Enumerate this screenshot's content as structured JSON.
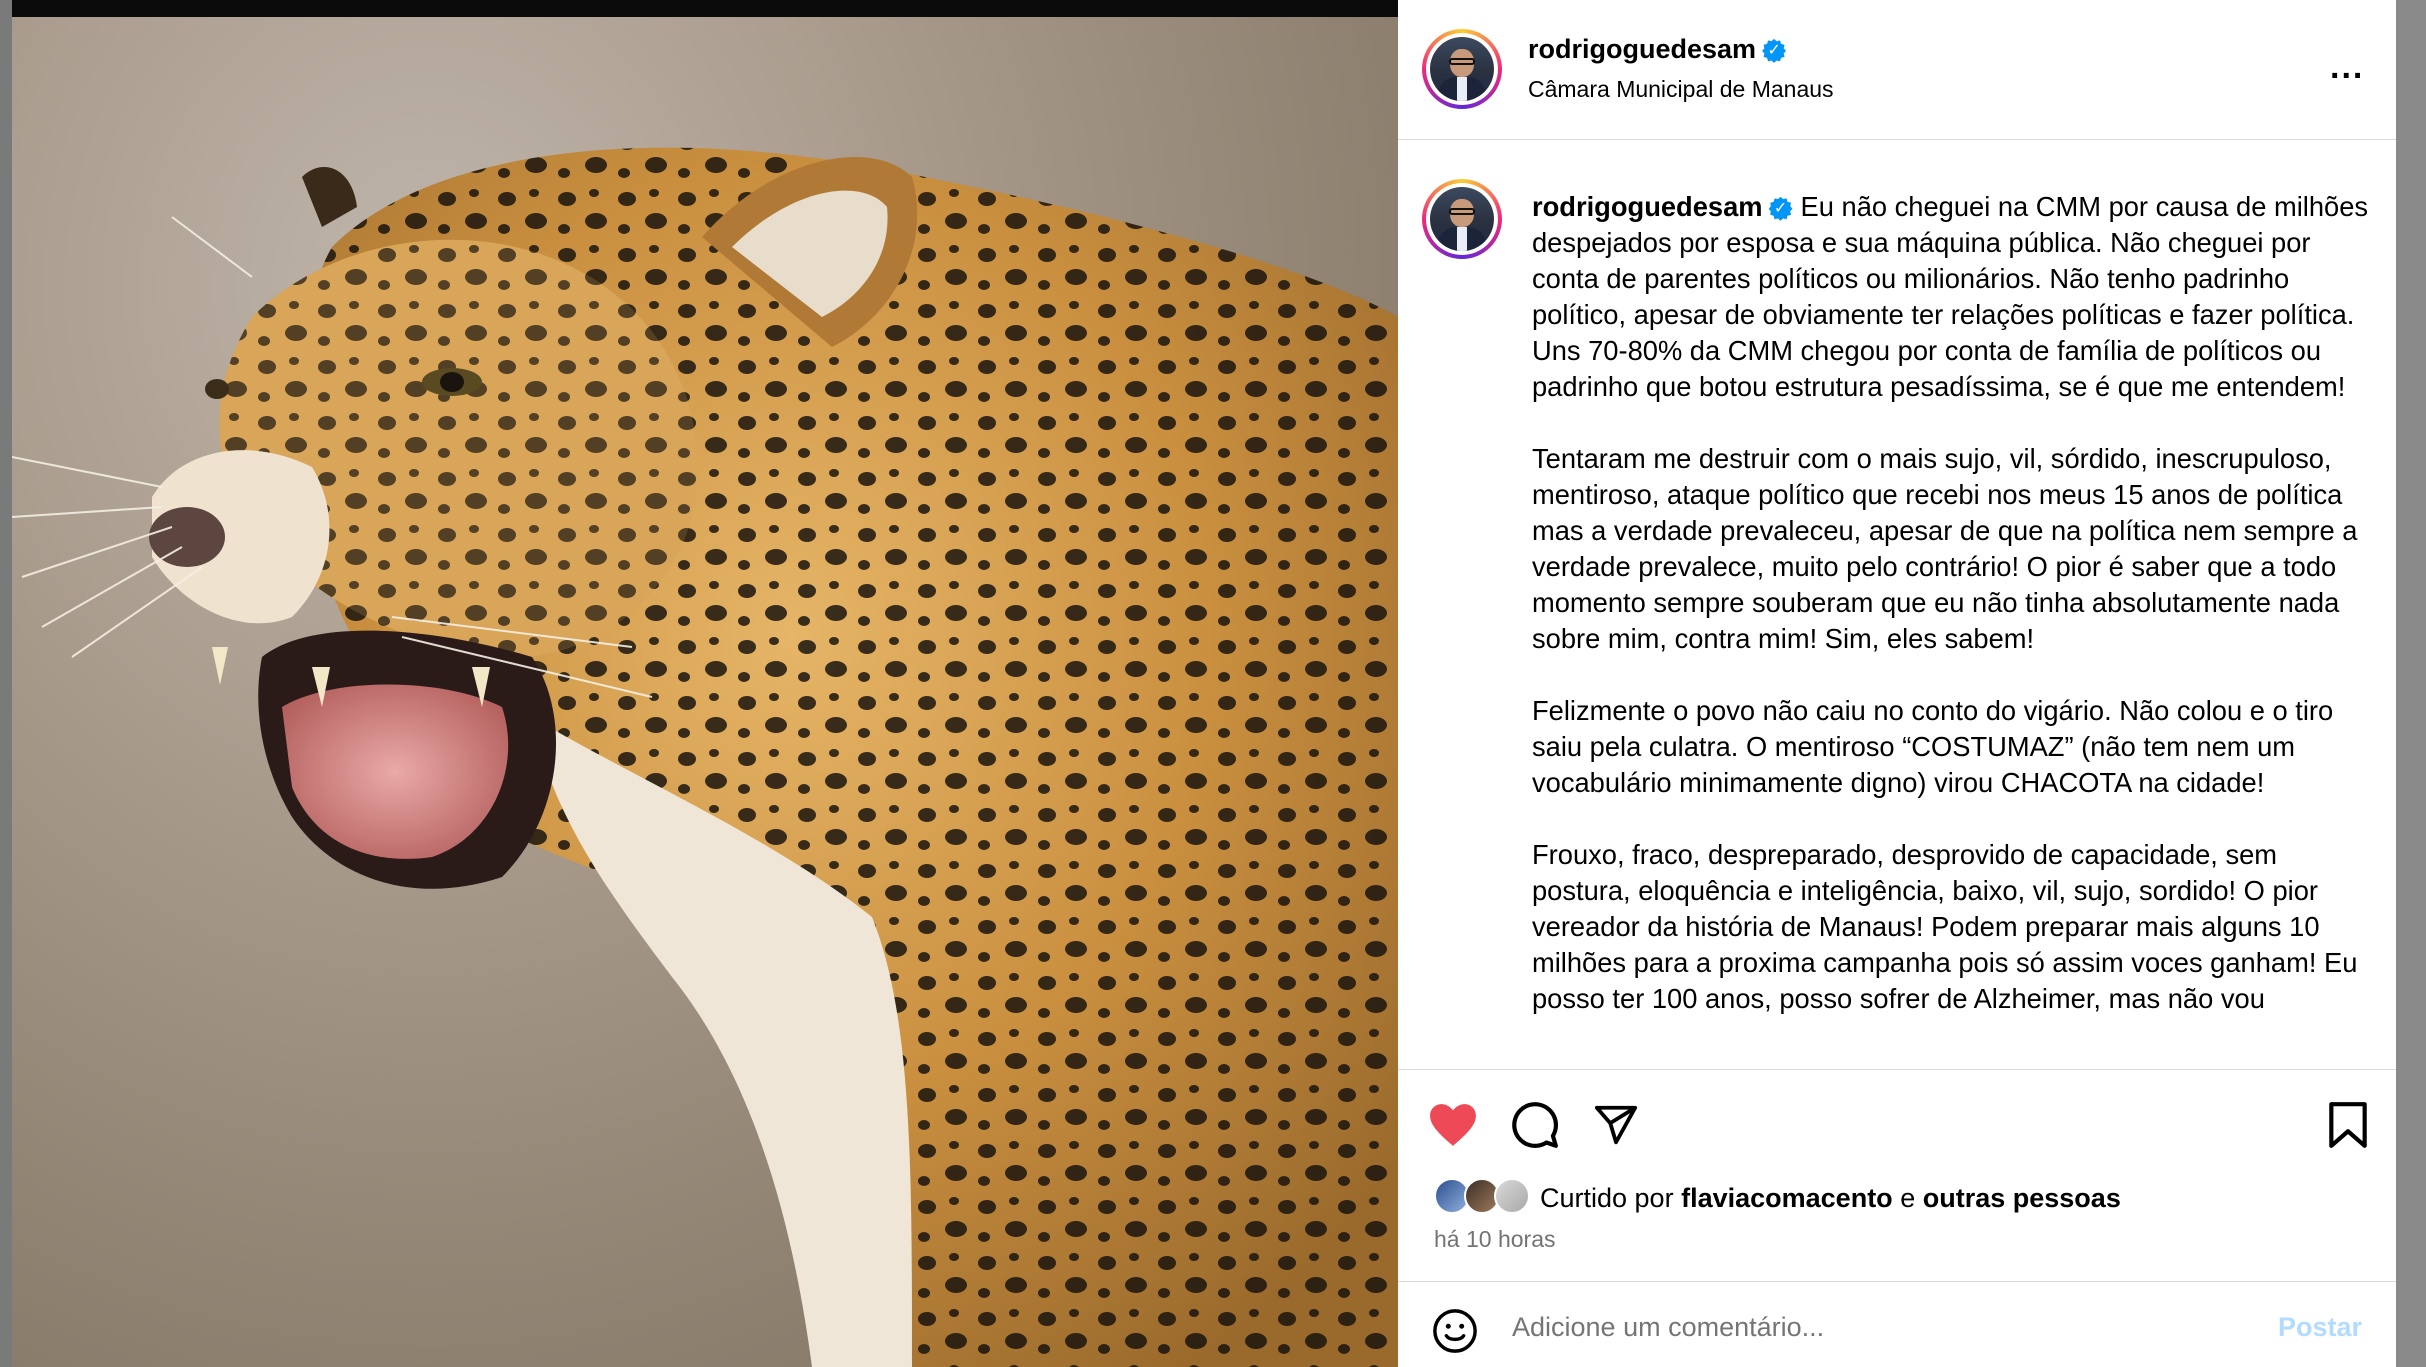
{
  "post": {
    "username": "rodrigoguedesam",
    "location": "Câmara Municipal de Manaus",
    "caption_paragraphs": [
      "Eu não cheguei na CMM por causa de milhões despejados por esposa e sua máquina pública. Não cheguei por conta de parentes políticos ou milionários. Não tenho padrinho político, apesar de obviamente ter relações políticas e fazer política. Uns 70-80% da CMM chegou por conta de família de políticos ou padrinho que botou estrutura pesadíssima, se é que me entendem!",
      "Tentaram me destruir com o mais sujo, vil, sórdido, inescrupuloso, mentiroso, ataque político que recebi nos meus 15 anos de política mas a verdade prevaleceu, apesar de que na política nem sempre a verdade prevalece, muito pelo contrário! O pior é saber que a todo momento sempre souberam que eu não tinha absolutamente nada sobre mim, contra mim! Sim, eles sabem!",
      "Felizmente o povo não caiu no conto do vigário. Não colou e o tiro saiu pela culatra. O mentiroso “COSTUMAZ” (não tem nem um vocabulário minimamente digno) virou CHACOTA na cidade!",
      "Frouxo, fraco, despreparado, desprovido de capacidade, sem postura, eloquência e inteligência, baixo, vil, sujo, sordido! O pior vereador da história de Manaus! Podem preparar mais alguns 10 milhões para a proxima campanha pois só assim voces ganham! Eu posso ter 100 anos, posso sofrer de Alzheimer, mas não vou"
    ],
    "liked_prefix": "Curtido por",
    "liked_user": "flaviacomacento",
    "liked_joiner": "e",
    "liked_others": "outras pessoas",
    "time_ago": "há 10 horas",
    "comment_placeholder": "Adicione um comentário...",
    "post_button": "Postar",
    "more_label": "..."
  },
  "icons": {
    "like": "heart-icon",
    "comment": "comment-icon",
    "share": "share-icon",
    "save": "bookmark-icon",
    "emoji": "emoji-icon",
    "verified": "verified-badge-icon",
    "more": "more-options-icon"
  },
  "colors": {
    "like_active": "#ed4956",
    "verified": "#0095f6",
    "post_button_disabled": "#b3dbff",
    "secondary_text": "#737373"
  }
}
